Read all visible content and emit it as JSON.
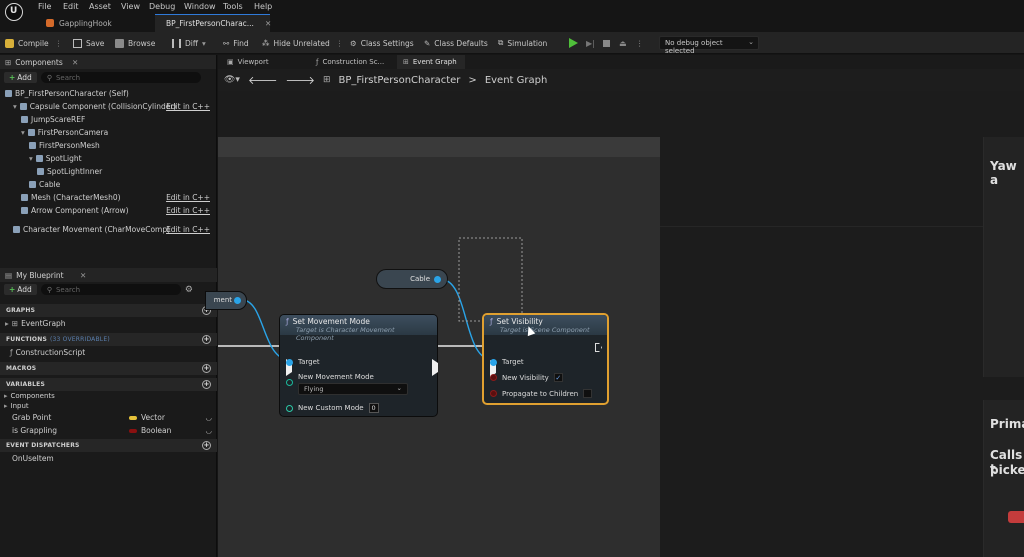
{
  "menu": [
    "File",
    "Edit",
    "Asset",
    "View",
    "Debug",
    "Window",
    "Tools",
    "Help"
  ],
  "doc_tabs": [
    {
      "label": "GapplingHook"
    },
    {
      "label": "BP_FirstPersonCharac..."
    }
  ],
  "toolbar": {
    "compile": "Compile",
    "save": "Save",
    "browse": "Browse",
    "diff": "Diff",
    "find": "Find",
    "hide_unrelated": "Hide Unrelated",
    "class_settings": "Class Settings",
    "class_defaults": "Class Defaults",
    "simulation": "Simulation",
    "debug_object": "No debug object selected"
  },
  "components": {
    "tab": "Components",
    "add": "Add",
    "search_placeholder": "Search",
    "edit_in_cpp": "Edit in C++",
    "items": [
      {
        "label": "BP_FirstPersonCharacter (Self)",
        "indent": 0,
        "edit": false
      },
      {
        "label": "Capsule Component (CollisionCylinder)",
        "indent": 1,
        "edit": true
      },
      {
        "label": "JumpScareREF",
        "indent": 2,
        "edit": false
      },
      {
        "label": "FirstPersonCamera",
        "indent": 2,
        "edit": false
      },
      {
        "label": "FirstPersonMesh",
        "indent": 3,
        "edit": false
      },
      {
        "label": "SpotLight",
        "indent": 3,
        "edit": false
      },
      {
        "label": "SpotLightInner",
        "indent": 4,
        "edit": false
      },
      {
        "label": "Cable",
        "indent": 3,
        "edit": false
      },
      {
        "label": "Mesh (CharacterMesh0)",
        "indent": 2,
        "edit": true
      },
      {
        "label": "Arrow Component (Arrow)",
        "indent": 2,
        "edit": true
      },
      {
        "label": "Character Movement (CharMoveComp)",
        "indent": 1,
        "edit": true
      }
    ]
  },
  "my_blueprint": {
    "tab": "My Blueprint",
    "add": "Add",
    "search_placeholder": "Search",
    "graphs_header": "GRAPHS",
    "event_graph": "EventGraph",
    "functions_header": "FUNCTIONS",
    "functions_sub": "(33 OVERRIDABLE)",
    "construction_script": "ConstructionScript",
    "macros_header": "MACROS",
    "variables_header": "VARIABLES",
    "var_groups": [
      "Components",
      "Input"
    ],
    "variables": [
      {
        "name": "Grab Point",
        "type": "Vector",
        "color": "#e6c23a"
      },
      {
        "name": "is Grappling",
        "type": "Boolean",
        "color": "#8a1010"
      }
    ],
    "dispatchers_header": "EVENT DISPATCHERS",
    "on_use_item": "OnUseItem"
  },
  "graph_tabs": [
    {
      "label": "Viewport"
    },
    {
      "label": "Construction Sc..."
    },
    {
      "label": "Event Graph"
    }
  ],
  "breadcrumb": {
    "blueprint": "BP_FirstPersonCharacter",
    "sep": ">",
    "graph": "Event Graph"
  },
  "nodes": {
    "event_partial": "ment",
    "cable_var": "Cable",
    "set_movement": {
      "title": "Set Movement Mode",
      "subtitle": "Target is Character Movement Component",
      "target": "Target",
      "new_mode_label": "New Movement Mode",
      "new_mode_value": "Flying",
      "custom_mode_label": "New Custom Mode",
      "custom_mode_value": "0"
    },
    "set_visibility": {
      "title": "Set Visibility",
      "subtitle": "Target is Scene Component",
      "target": "Target",
      "new_visibility": "New Visibility",
      "new_visibility_checked": true,
      "propagate": "Propagate to Children",
      "propagate_checked": false
    }
  },
  "right_partial": {
    "yaw": "Yaw a",
    "prima": "Prima",
    "calls": "Calls t",
    "picked": "picked"
  }
}
